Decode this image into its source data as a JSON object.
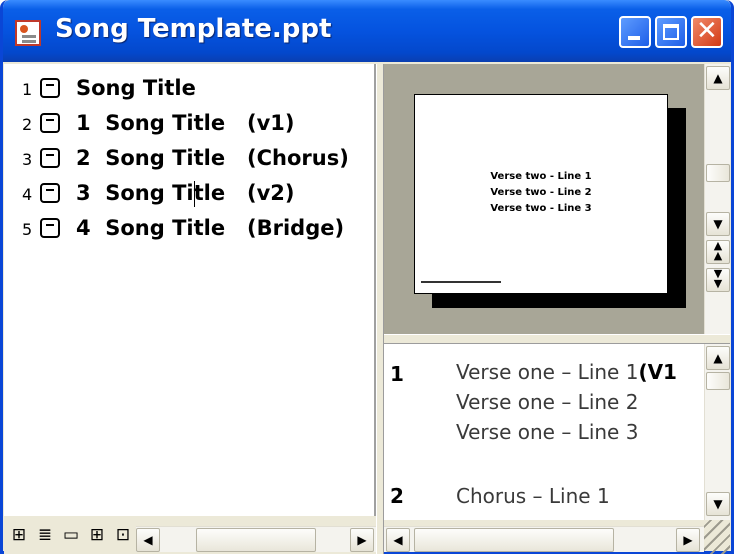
{
  "window": {
    "title": "Song Template.ppt"
  },
  "outline": {
    "items": [
      {
        "num": "1",
        "text": "Song Title"
      },
      {
        "num": "2",
        "text": "1  Song Title   (v1)"
      },
      {
        "num": "3",
        "text": "2  Song Title   (Chorus)"
      },
      {
        "num": "4",
        "text": "3  Song Title   (v2)"
      },
      {
        "num": "5",
        "text": "4  Song Title   (Bridge)"
      }
    ]
  },
  "slide_preview": {
    "lines": [
      "Verse two - Line 1",
      "Verse two - Line 2",
      "Verse two - Line 3"
    ]
  },
  "notes": {
    "entries": [
      {
        "num": "1",
        "lines": [
          "Verse one – Line 1",
          "Verse one – Line 2",
          "Verse one – Line 3"
        ],
        "tag": "(V1"
      },
      {
        "num": "2",
        "lines": [
          "Chorus – Line 1"
        ]
      }
    ]
  },
  "view_buttons": [
    "normal-view",
    "outline-view",
    "slide-view",
    "slide-sorter-view",
    "slide-show"
  ],
  "colors": {
    "titlebar": "#0553df",
    "close": "#d33a15",
    "slide_bg": "#a8a697"
  }
}
